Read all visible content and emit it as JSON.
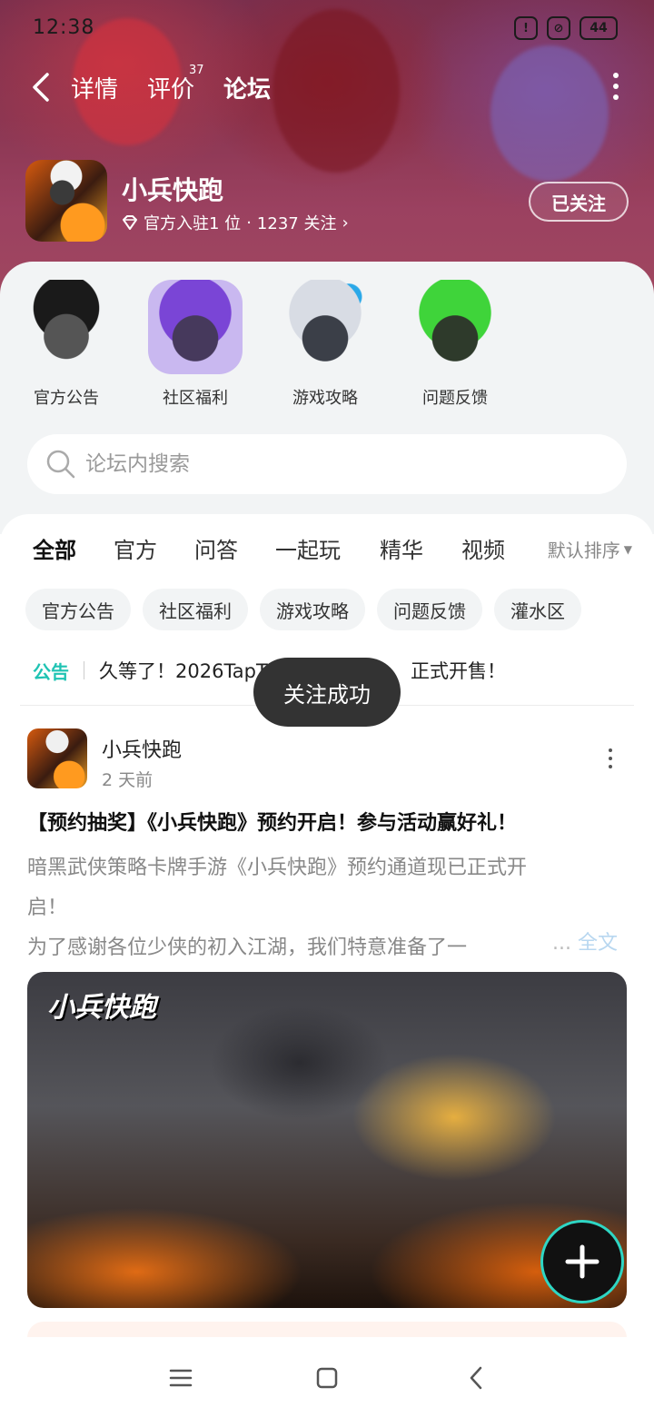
{
  "status_bar": {
    "time": "12:38",
    "battery": "44"
  },
  "nav": {
    "tabs": [
      {
        "label": "详情"
      },
      {
        "label": "评价",
        "badge": "37"
      },
      {
        "label": "论坛"
      }
    ],
    "active_tab": "论坛"
  },
  "game": {
    "name": "小兵快跑",
    "meta_official": "官方入驻1 位",
    "meta_dot": "·",
    "meta_followers": "1237 关注",
    "follow_button": "已关注"
  },
  "categories": [
    {
      "label": "官方公告"
    },
    {
      "label": "社区福利"
    },
    {
      "label": "游戏攻略"
    },
    {
      "label": "问题反馈"
    }
  ],
  "search": {
    "placeholder": "论坛内搜索"
  },
  "filter_tabs": [
    "全部",
    "官方",
    "问答",
    "一起玩",
    "精华",
    "视频"
  ],
  "sort_label": "默认排序",
  "chips": [
    "官方公告",
    "社区福利",
    "游戏攻略",
    "问题反馈",
    "灌水区"
  ],
  "notice": {
    "tag": "公告",
    "text": "久等了！2026TapT",
    "text_tail": "正式开售！"
  },
  "post": {
    "author": "小兵快跑",
    "time": "2 天前",
    "title": "【预约抽奖】《小兵快跑》预约开启！参与活动赢好礼！",
    "body_line1": "暗黑武侠策略卡牌手游《小兵快跑》预约通道现已正式开",
    "body_line2": "启！",
    "body_line3": "为了感谢各位少侠的初入江湖，我们特意准备了一",
    "ellipsis": "...",
    "more": "全文",
    "image_logo": "小兵快跑"
  },
  "toast": "关注成功",
  "colors": {
    "accent": "#2ed6c4",
    "notice_tag": "#1fc3b3",
    "toast_bg": "#333333"
  }
}
